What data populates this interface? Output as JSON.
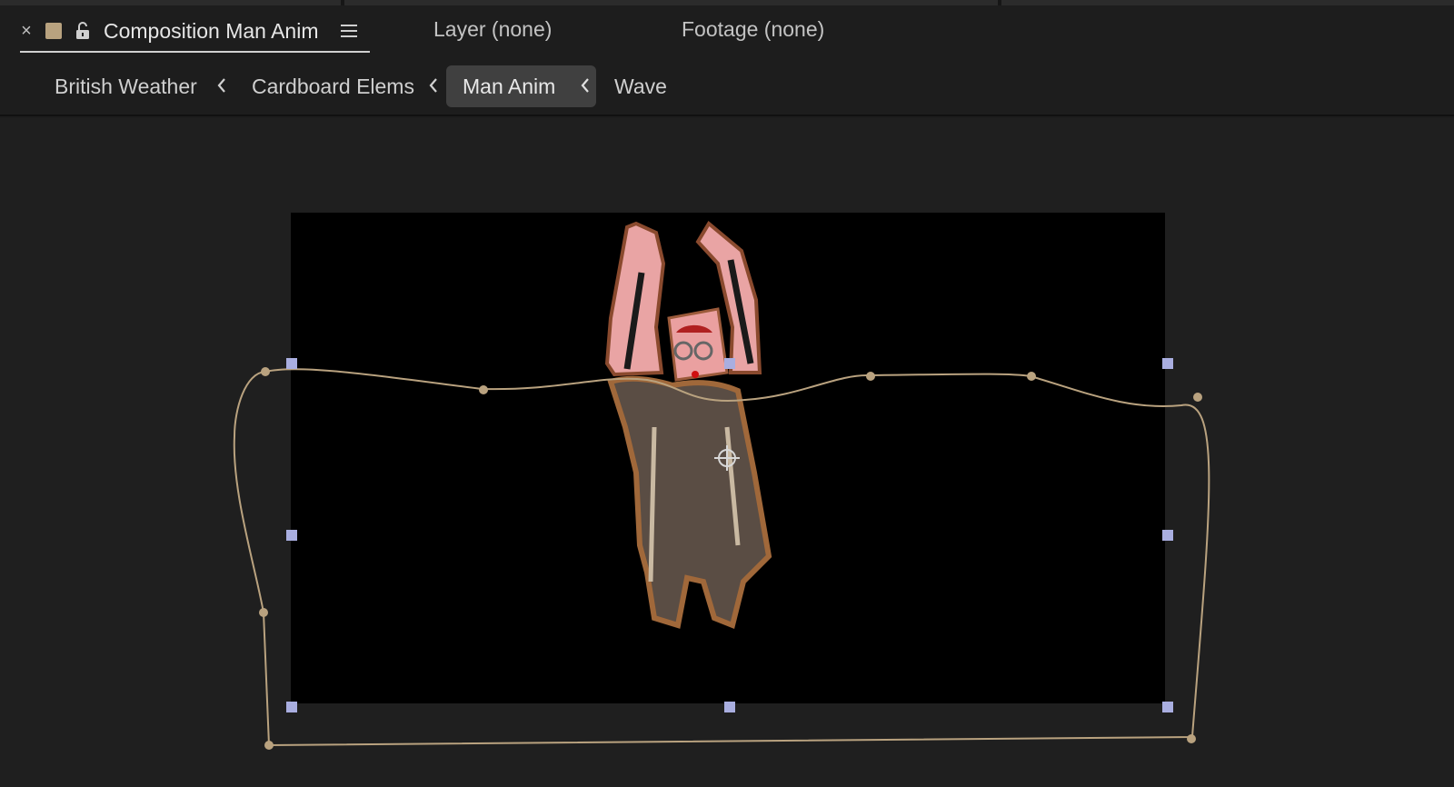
{
  "tabs": {
    "composition_tab": {
      "close_label": "×",
      "title": "Composition Man Anim"
    },
    "layer_tab": "Layer (none)",
    "footage_tab": "Footage (none)"
  },
  "breadcrumb": {
    "items": [
      {
        "label": "British Weather"
      },
      {
        "label": "Cardboard Elems"
      },
      {
        "label": "Man Anim",
        "active": true
      },
      {
        "label": "Wave"
      }
    ]
  },
  "colors": {
    "comp_swatch": "#b8a27f",
    "path_stroke": "#b9a27f",
    "handle_fill": "#a9aee0"
  },
  "icons": [
    "close-icon",
    "color-swatch",
    "lock-icon",
    "panel-menu-icon",
    "chevron-left-icon",
    "anchor-point-icon"
  ]
}
